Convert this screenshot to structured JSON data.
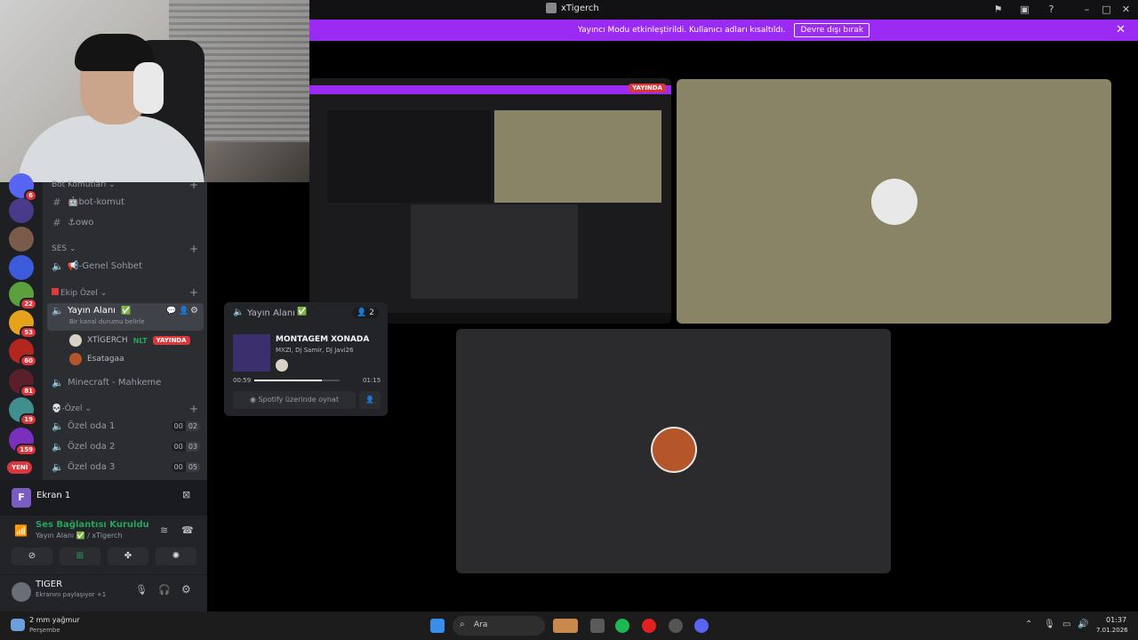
{
  "window": {
    "title": "xTigerch"
  },
  "banner": {
    "text": "Yayıncı Modu etkinleştirildi. Kullanıcı adları kısaltıldı.",
    "button_label": "Devre dışı bırak",
    "color": "#9b2af2"
  },
  "servers": [
    {
      "badge": "6"
    },
    {
      "badge": ""
    },
    {
      "badge": ""
    },
    {
      "badge": ""
    },
    {
      "badge": "22"
    },
    {
      "badge": "53"
    },
    {
      "badge": "60"
    },
    {
      "badge": "81"
    },
    {
      "badge": "19"
    },
    {
      "badge": "159"
    }
  ],
  "servers_new_label": "YENİ",
  "channels": {
    "bot_category": "Bot Komutları",
    "bot_channels": [
      "🤖bot-komut",
      "⚓owo"
    ],
    "ses_category": "SES",
    "genel_sohbet": "📢-Genel Sohbet",
    "ekip_category": "Ekip Özel",
    "active_channel": "Yayın Alanı",
    "active_status": "Bir kanal durumu belirle",
    "voice_users": [
      {
        "name": "XTİGERCH",
        "tag": "NLT",
        "badge": "YAYINDA"
      },
      {
        "name": "Esatagaa",
        "tag": "",
        "badge": ""
      }
    ],
    "minecraft_channel": "Minecraft - Mahkeme",
    "ozel_category": "💀-Özel",
    "ozel_rooms": [
      {
        "name": "Özel oda 1",
        "count": "00",
        "limit": "02"
      },
      {
        "name": "Özel oda 2",
        "count": "00",
        "limit": "03"
      },
      {
        "name": "Özel oda 3",
        "count": "00",
        "limit": "05"
      }
    ]
  },
  "panel": {
    "screen_label": "Ekran 1",
    "screen_initial": "F",
    "voice_status": "Ses Bağlantısı Kuruldu",
    "voice_channel": "Yayın Alanı ✅ / xTigerch",
    "user_name": "TIGER",
    "user_status": "Ekranını paylaşıyor +1"
  },
  "streams": {
    "live_badge": "YAYINDA"
  },
  "popup": {
    "channel_name": "Yayın Alanı",
    "member_count": "2",
    "track_title": "MONTAGEM XONADA",
    "track_artists": "MXZI, Dj Samir, DJ Javi26",
    "elapsed": "00:59",
    "duration": "01:15",
    "progress": 0.79,
    "spotify_button": "Spotify üzerinde oynat"
  },
  "taskbar": {
    "weather_temp": "2 mm yağmur",
    "weather_day": "Perşembe",
    "search_label": "Ara",
    "time": "01:37",
    "date": "7.01.2026"
  }
}
